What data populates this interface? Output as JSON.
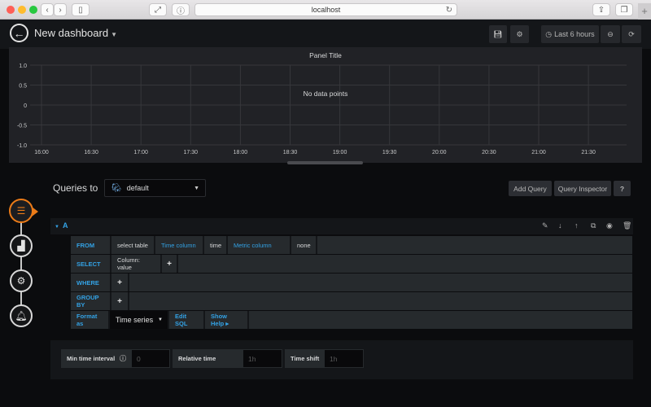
{
  "browser": {
    "url": "localhost",
    "colors": {
      "close": "#fe5f57",
      "minimize": "#febc2e",
      "maximize": "#28c840"
    }
  },
  "nav": {
    "dashboard_title": "New dashboard",
    "time_range": "Last 6 hours",
    "icons": [
      "back-arrow-icon",
      "save-icon",
      "gear-icon",
      "clock-icon",
      "zoom-out-icon",
      "refresh-icon"
    ]
  },
  "panel": {
    "title": "Panel Title",
    "no_data": "No data points"
  },
  "chart_data": {
    "type": "line",
    "title": "Panel Title",
    "annotation": "No data points",
    "x": [
      "16:00",
      "16:30",
      "17:00",
      "17:30",
      "18:00",
      "18:30",
      "19:00",
      "19:30",
      "20:00",
      "20:30",
      "21:00",
      "21:30"
    ],
    "y_ticks": [
      "1.0",
      "0.5",
      "0",
      "-0.5",
      "-1.0"
    ],
    "ylim": [
      -1.0,
      1.0
    ],
    "series": [],
    "grid": true,
    "xlabel": "",
    "ylabel": ""
  },
  "editor": {
    "queries_to_label": "Queries to",
    "datasource": "default",
    "add_query": "Add Query",
    "query_inspector": "Query Inspector",
    "help": "?",
    "accent_color": "#eb7b18",
    "rail": [
      "database-icon",
      "visualization-icon",
      "general-settings-icon",
      "alert-bell-icon"
    ]
  },
  "query": {
    "ref_id": "A",
    "rows": {
      "from": {
        "label": "FROM",
        "table": "select table",
        "time_col_label": "Time column",
        "time_col": "time",
        "metric_col_label": "Metric column",
        "metric_col": "none"
      },
      "select": {
        "label": "SELECT",
        "column": "Column: value",
        "add": "+"
      },
      "where": {
        "label": "WHERE",
        "add": "+"
      },
      "group_by": {
        "label": "GROUP BY",
        "add": "+"
      },
      "format": {
        "label": "Format as",
        "value": "Time series",
        "edit_sql": "Edit SQL",
        "show_help": "Show Help ▸"
      }
    }
  },
  "options": {
    "min_interval_label": "Min time interval",
    "min_interval_placeholder": "0",
    "relative_time_label": "Relative time",
    "relative_time_placeholder": "1h",
    "time_shift_label": "Time shift",
    "time_shift_placeholder": "1h"
  }
}
